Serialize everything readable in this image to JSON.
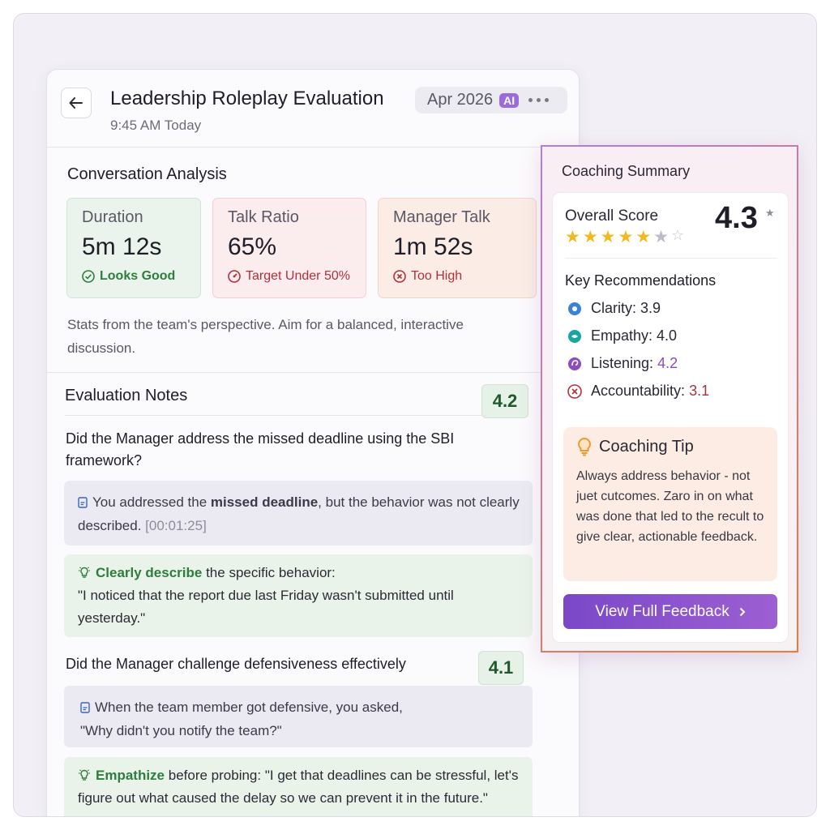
{
  "header": {
    "title": "Leadership Roleplay Evaluation",
    "subtitle": "9:45 AM Today",
    "date": "Apr 2026",
    "ai_badge": "AI"
  },
  "analysis": {
    "heading": "Conversation Analysis",
    "stats": [
      {
        "label": "Duration",
        "value": "5m 12s",
        "status": "Looks Good"
      },
      {
        "label": "Talk Ratio",
        "value": "65%",
        "status": "Target Under 50%"
      },
      {
        "label": "Manager Talk",
        "value": "1m 52s",
        "status": "Too High"
      }
    ],
    "note": "Stats from the team's perspective. Aim for a balanced, interactive discussion."
  },
  "notes": {
    "heading": "Evaluation Notes",
    "score": "4.2",
    "items": [
      {
        "question": "Did the Manager address the missed deadline using the SBI framework?",
        "quote_pre": "You addressed the ",
        "quote_bold": "missed deadline",
        "quote_post": ", but the behavior was not clearly described.",
        "timestamp": "[00:01:25]",
        "tip_highlight": "Clearly describe",
        "tip_rest": " the specific behavior:",
        "tip_quote": "\"I noticed that the report due last Friday wasn't submitted until yesterday.\""
      },
      {
        "question": "Did the Manager challenge defensiveness effectively",
        "score": "4.1",
        "quote_line1": "When the team member got defensive, you asked,",
        "quote_line2": "\"Why didn't you notify the team?\"",
        "tip_highlight": "Empathize",
        "tip_rest": " before probing: \"I get that deadlines can be stressful, let's figure out what caused the delay so we can prevent it in the future.\""
      }
    ]
  },
  "summary": {
    "title": "Coaching Summary",
    "overall_label": "Overall Score",
    "overall_score": "4.3",
    "stars_rating": 5,
    "stars_max": 7,
    "recommendations_title": "Key Recommendations",
    "recommendations": [
      {
        "label": "Clarity: ",
        "value": "3.9",
        "color": "#3b82d6"
      },
      {
        "label": "Empathy: ",
        "value": "4.0",
        "color": "#1aa6a0"
      },
      {
        "label": "Listening: ",
        "value": "4.2",
        "color": "#8b4cc4"
      },
      {
        "label": "Accountability: ",
        "value": "3.1",
        "color": "#b1303b"
      }
    ],
    "tip_title": "Coaching Tip",
    "tip_body": "Always address behavior - not juet cutcomes. Zaro in on what was done that led to the recult to give clear, actionable feedback.",
    "cta_label": "View Full Feedback"
  },
  "colors": {
    "accent": "#8b4cc4",
    "good": "#2d7d3c",
    "bad": "#b1303b"
  }
}
